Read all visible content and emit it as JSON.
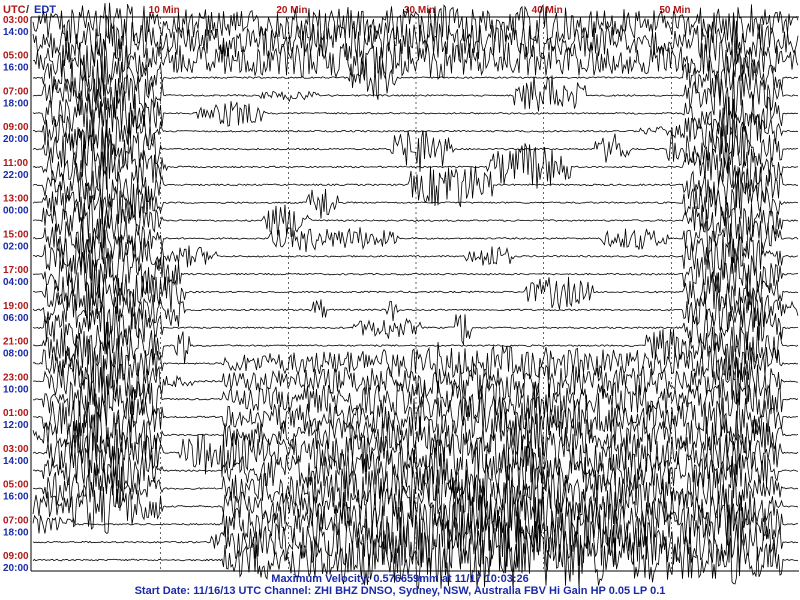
{
  "header": {
    "utc_label": "UTC",
    "separator": "/",
    "local_label": "EDT"
  },
  "footer": {
    "max_velocity": "Maximum Velocity: 0.576659mm at 11/17 10:03:26",
    "start_info": "Start Date: 11/16/13 UTC Channel: ZHI  BHZ  DNSO, Sydney, NSW, Australia  FBV Hi Gain HP 0.05 LP 0.1"
  },
  "colors": {
    "utc": "#b01818",
    "local": "#1a2aa8",
    "trace": "#000000",
    "grid": "#000000",
    "footer": "#1a2aa8"
  },
  "chart_data": {
    "type": "line",
    "x_unit": "Min",
    "xlim": [
      0,
      60
    ],
    "x_ticks": [
      {
        "value": 10,
        "label": "10 Min"
      },
      {
        "value": 20,
        "label": "20 Min"
      },
      {
        "value": 30,
        "label": "30 Min"
      },
      {
        "value": 40,
        "label": "40 Min"
      },
      {
        "value": 50,
        "label": "50 Min"
      }
    ],
    "utc_hour_labels": [
      "03:00",
      "05:00",
      "07:00",
      "09:00",
      "11:00",
      "13:00",
      "15:00",
      "17:00",
      "19:00",
      "21:00",
      "23:00",
      "01:00",
      "03:00",
      "05:00",
      "07:00",
      "09:00"
    ],
    "local_hour_labels": [
      "14:00",
      "16:00",
      "18:00",
      "20:00",
      "22:00",
      "00:00",
      "02:00",
      "04:00",
      "06:00",
      "08:00",
      "10:00",
      "12:00",
      "14:00",
      "16:00",
      "18:00",
      "20:00"
    ],
    "trace_count": 31,
    "grid": "dashed vertical at 10-minute ticks"
  }
}
